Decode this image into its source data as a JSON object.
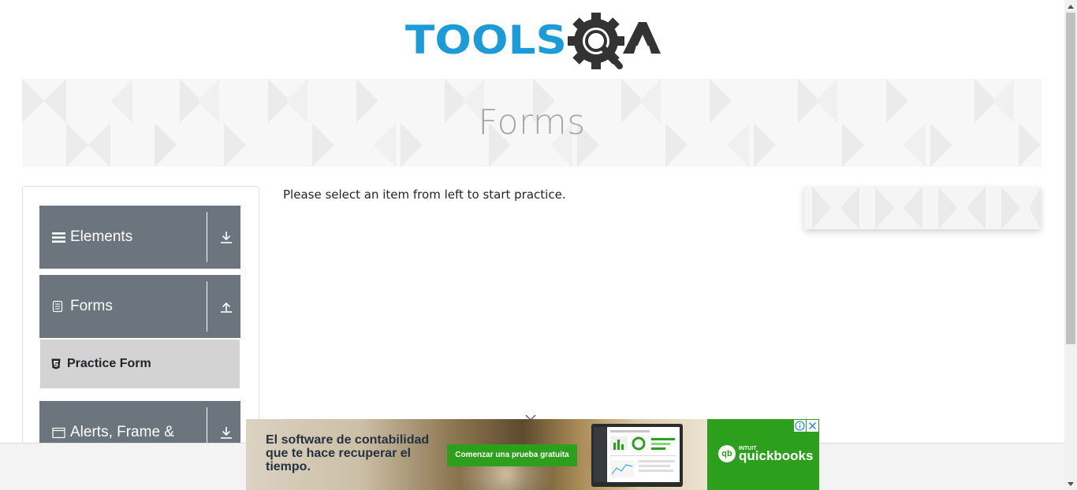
{
  "header": {
    "logo_text": "TOOLSQA",
    "logo_icon": "gear-magnifier-icon",
    "colors": {
      "logo_blue": "#1b9bd8",
      "logo_dark": "#333333"
    }
  },
  "banner": {
    "title": "Forms"
  },
  "sidebar": {
    "groups": [
      {
        "label": "Elements",
        "icon": "hamburger-icon",
        "arrow": "download-arrow-icon"
      },
      {
        "label": "Forms",
        "icon": "document-icon",
        "arrow": "upload-arrow-icon"
      },
      {
        "label": "Alerts, Frame &",
        "icon": "window-icon",
        "arrow": "download-arrow-icon"
      }
    ],
    "active_item": {
      "label": "Practice Form",
      "icon": "html5-shield-icon"
    },
    "colors": {
      "group_bg": "#6c757d",
      "active_bg": "#d3d3d3"
    }
  },
  "main": {
    "message": "Please select an item from left to start practice."
  },
  "ad": {
    "headline": "El software de contabilidad que te hace recuperar el tiempo.",
    "cta": "Comenzar una prueba gratuita",
    "brand_prefix": "INTUIT",
    "brand_name": "quickbooks",
    "brand_mark": "qb",
    "info_icon": "info-icon",
    "close_icon": "close-icon",
    "colors": {
      "brand_green": "#2ca01c"
    }
  }
}
